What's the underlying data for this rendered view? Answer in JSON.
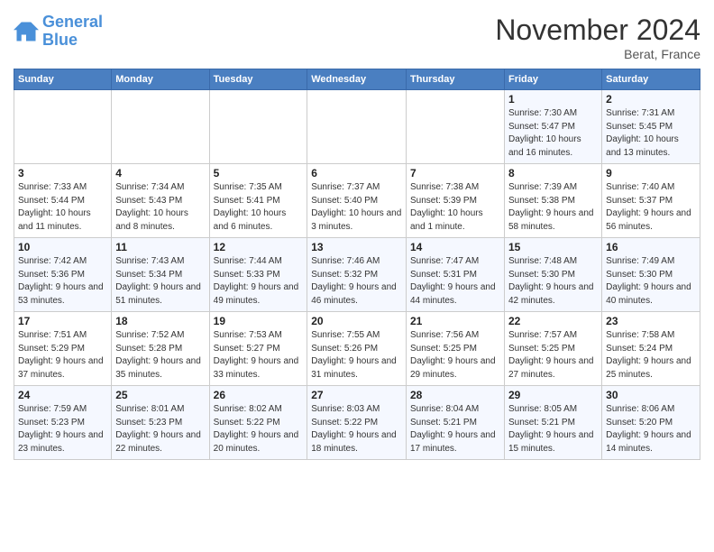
{
  "header": {
    "logo_line1": "General",
    "logo_line2": "Blue",
    "month": "November 2024",
    "location": "Berat, France"
  },
  "weekdays": [
    "Sunday",
    "Monday",
    "Tuesday",
    "Wednesday",
    "Thursday",
    "Friday",
    "Saturday"
  ],
  "weeks": [
    [
      {
        "day": "",
        "info": ""
      },
      {
        "day": "",
        "info": ""
      },
      {
        "day": "",
        "info": ""
      },
      {
        "day": "",
        "info": ""
      },
      {
        "day": "",
        "info": ""
      },
      {
        "day": "1",
        "info": "Sunrise: 7:30 AM\nSunset: 5:47 PM\nDaylight: 10 hours and 16 minutes."
      },
      {
        "day": "2",
        "info": "Sunrise: 7:31 AM\nSunset: 5:45 PM\nDaylight: 10 hours and 13 minutes."
      }
    ],
    [
      {
        "day": "3",
        "info": "Sunrise: 7:33 AM\nSunset: 5:44 PM\nDaylight: 10 hours and 11 minutes."
      },
      {
        "day": "4",
        "info": "Sunrise: 7:34 AM\nSunset: 5:43 PM\nDaylight: 10 hours and 8 minutes."
      },
      {
        "day": "5",
        "info": "Sunrise: 7:35 AM\nSunset: 5:41 PM\nDaylight: 10 hours and 6 minutes."
      },
      {
        "day": "6",
        "info": "Sunrise: 7:37 AM\nSunset: 5:40 PM\nDaylight: 10 hours and 3 minutes."
      },
      {
        "day": "7",
        "info": "Sunrise: 7:38 AM\nSunset: 5:39 PM\nDaylight: 10 hours and 1 minute."
      },
      {
        "day": "8",
        "info": "Sunrise: 7:39 AM\nSunset: 5:38 PM\nDaylight: 9 hours and 58 minutes."
      },
      {
        "day": "9",
        "info": "Sunrise: 7:40 AM\nSunset: 5:37 PM\nDaylight: 9 hours and 56 minutes."
      }
    ],
    [
      {
        "day": "10",
        "info": "Sunrise: 7:42 AM\nSunset: 5:36 PM\nDaylight: 9 hours and 53 minutes."
      },
      {
        "day": "11",
        "info": "Sunrise: 7:43 AM\nSunset: 5:34 PM\nDaylight: 9 hours and 51 minutes."
      },
      {
        "day": "12",
        "info": "Sunrise: 7:44 AM\nSunset: 5:33 PM\nDaylight: 9 hours and 49 minutes."
      },
      {
        "day": "13",
        "info": "Sunrise: 7:46 AM\nSunset: 5:32 PM\nDaylight: 9 hours and 46 minutes."
      },
      {
        "day": "14",
        "info": "Sunrise: 7:47 AM\nSunset: 5:31 PM\nDaylight: 9 hours and 44 minutes."
      },
      {
        "day": "15",
        "info": "Sunrise: 7:48 AM\nSunset: 5:30 PM\nDaylight: 9 hours and 42 minutes."
      },
      {
        "day": "16",
        "info": "Sunrise: 7:49 AM\nSunset: 5:30 PM\nDaylight: 9 hours and 40 minutes."
      }
    ],
    [
      {
        "day": "17",
        "info": "Sunrise: 7:51 AM\nSunset: 5:29 PM\nDaylight: 9 hours and 37 minutes."
      },
      {
        "day": "18",
        "info": "Sunrise: 7:52 AM\nSunset: 5:28 PM\nDaylight: 9 hours and 35 minutes."
      },
      {
        "day": "19",
        "info": "Sunrise: 7:53 AM\nSunset: 5:27 PM\nDaylight: 9 hours and 33 minutes."
      },
      {
        "day": "20",
        "info": "Sunrise: 7:55 AM\nSunset: 5:26 PM\nDaylight: 9 hours and 31 minutes."
      },
      {
        "day": "21",
        "info": "Sunrise: 7:56 AM\nSunset: 5:25 PM\nDaylight: 9 hours and 29 minutes."
      },
      {
        "day": "22",
        "info": "Sunrise: 7:57 AM\nSunset: 5:25 PM\nDaylight: 9 hours and 27 minutes."
      },
      {
        "day": "23",
        "info": "Sunrise: 7:58 AM\nSunset: 5:24 PM\nDaylight: 9 hours and 25 minutes."
      }
    ],
    [
      {
        "day": "24",
        "info": "Sunrise: 7:59 AM\nSunset: 5:23 PM\nDaylight: 9 hours and 23 minutes."
      },
      {
        "day": "25",
        "info": "Sunrise: 8:01 AM\nSunset: 5:23 PM\nDaylight: 9 hours and 22 minutes."
      },
      {
        "day": "26",
        "info": "Sunrise: 8:02 AM\nSunset: 5:22 PM\nDaylight: 9 hours and 20 minutes."
      },
      {
        "day": "27",
        "info": "Sunrise: 8:03 AM\nSunset: 5:22 PM\nDaylight: 9 hours and 18 minutes."
      },
      {
        "day": "28",
        "info": "Sunrise: 8:04 AM\nSunset: 5:21 PM\nDaylight: 9 hours and 17 minutes."
      },
      {
        "day": "29",
        "info": "Sunrise: 8:05 AM\nSunset: 5:21 PM\nDaylight: 9 hours and 15 minutes."
      },
      {
        "day": "30",
        "info": "Sunrise: 8:06 AM\nSunset: 5:20 PM\nDaylight: 9 hours and 14 minutes."
      }
    ]
  ]
}
